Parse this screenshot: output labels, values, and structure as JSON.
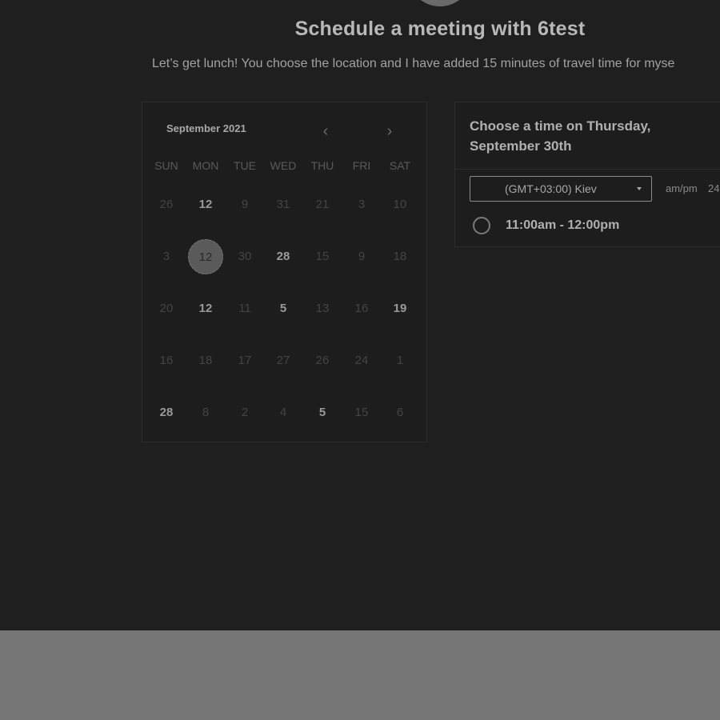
{
  "header": {
    "title": "Schedule a meeting with 6test",
    "subtitle": "Let’s get lunch! You choose the location and I have added 15 minutes of travel time for myse"
  },
  "calendar": {
    "month_label": "September 2021",
    "prev_icon": "chevron-left-icon",
    "next_icon": "chevron-right-icon",
    "prev_glyph": "‹",
    "next_glyph": "›",
    "weekdays": [
      "SUN",
      "MON",
      "TUE",
      "WED",
      "THU",
      "FRI",
      "SAT"
    ],
    "weeks": [
      [
        {
          "d": "26",
          "s": "muted"
        },
        {
          "d": "12",
          "s": "active"
        },
        {
          "d": "9",
          "s": "muted"
        },
        {
          "d": "31",
          "s": "muted"
        },
        {
          "d": "21",
          "s": "muted"
        },
        {
          "d": "3",
          "s": "muted"
        },
        {
          "d": "10",
          "s": "muted"
        }
      ],
      [
        {
          "d": "3",
          "s": "muted"
        },
        {
          "d": "12",
          "s": "selected"
        },
        {
          "d": "30",
          "s": "muted"
        },
        {
          "d": "28",
          "s": "active"
        },
        {
          "d": "15",
          "s": "muted"
        },
        {
          "d": "9",
          "s": "muted"
        },
        {
          "d": "18",
          "s": "muted"
        }
      ],
      [
        {
          "d": "20",
          "s": "muted"
        },
        {
          "d": "12",
          "s": "active"
        },
        {
          "d": "11",
          "s": "muted"
        },
        {
          "d": "5",
          "s": "active"
        },
        {
          "d": "13",
          "s": "muted"
        },
        {
          "d": "16",
          "s": "muted"
        },
        {
          "d": "19",
          "s": "active"
        }
      ],
      [
        {
          "d": "16",
          "s": "muted"
        },
        {
          "d": "18",
          "s": "muted"
        },
        {
          "d": "17",
          "s": "muted"
        },
        {
          "d": "27",
          "s": "muted"
        },
        {
          "d": "26",
          "s": "muted"
        },
        {
          "d": "24",
          "s": "muted"
        },
        {
          "d": "1",
          "s": "muted"
        }
      ],
      [
        {
          "d": "28",
          "s": "active"
        },
        {
          "d": "8",
          "s": "muted"
        },
        {
          "d": "2",
          "s": "muted"
        },
        {
          "d": "4",
          "s": "muted"
        },
        {
          "d": "5",
          "s": "active"
        },
        {
          "d": "15",
          "s": "muted"
        },
        {
          "d": "6",
          "s": "muted"
        }
      ]
    ]
  },
  "time_panel": {
    "heading": "Choose a time on Thursday, September 30th",
    "timezone": "(GMT+03:00) Kiev",
    "format_12": "am/pm",
    "format_24": "24",
    "slots": [
      {
        "label": "11:00am - 12:00pm",
        "selected": false
      }
    ]
  },
  "colors": {
    "page_bg": "#1f1f1f",
    "overlay_bottom": "#777777",
    "active_text": "#9a9a9a",
    "muted_text": "#444444"
  }
}
